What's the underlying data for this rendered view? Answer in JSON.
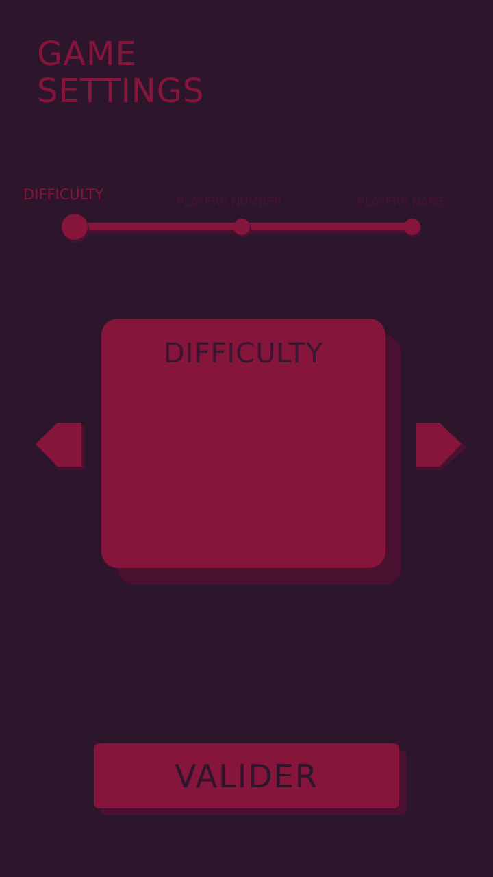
{
  "header": {
    "title_line1": "GAME",
    "title_line2": "SETTINGS"
  },
  "stepper": {
    "steps": [
      {
        "label": "DIFFICULTY",
        "active": true
      },
      {
        "label": "PLAYERS NUMBER",
        "active": false
      },
      {
        "label": "PLAYERS NAME",
        "active": false
      }
    ],
    "current_step": 1,
    "total_steps": 3
  },
  "carousel": {
    "card_title": "DIFFICULTY",
    "prev_icon": "chevron-left-icon",
    "next_icon": "chevron-right-icon"
  },
  "actions": {
    "validate_label": "VALIDER"
  },
  "colors": {
    "background": "#2d152b",
    "accent": "#85153a",
    "shadow": "#4a1030",
    "text_dark": "#3a1530"
  }
}
